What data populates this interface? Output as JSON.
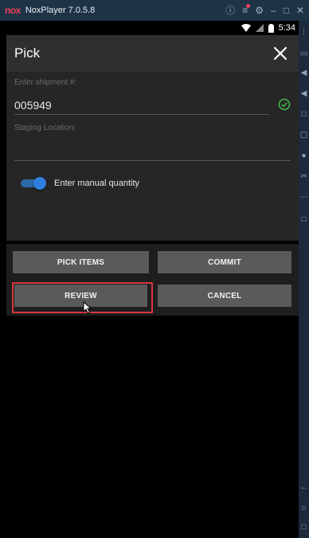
{
  "emulator": {
    "logo": "nox",
    "title": "NoxPlayer 7.0.5.8",
    "controls": [
      "help-icon",
      "menu-icon",
      "settings-icon",
      "minimize-icon",
      "maximize-icon",
      "close-icon"
    ]
  },
  "statusbar": {
    "time": "5:34"
  },
  "appbar": {
    "title": "Pick"
  },
  "form": {
    "shipment_label": "Enter shipment #:",
    "shipment_value": "005949",
    "staging_label": "Staging Location:",
    "staging_value": "",
    "manual_qty_label": "Enter manual quantity",
    "manual_qty_enabled": true
  },
  "buttons": {
    "pick_items": "PICK ITEMS",
    "commit": "COMMIT",
    "review": "REVIEW",
    "cancel": "CANCEL"
  },
  "colors": {
    "accent_toggle": "#2f7fe0",
    "check_green": "#3fb950",
    "highlight_red": "#d9373f"
  }
}
